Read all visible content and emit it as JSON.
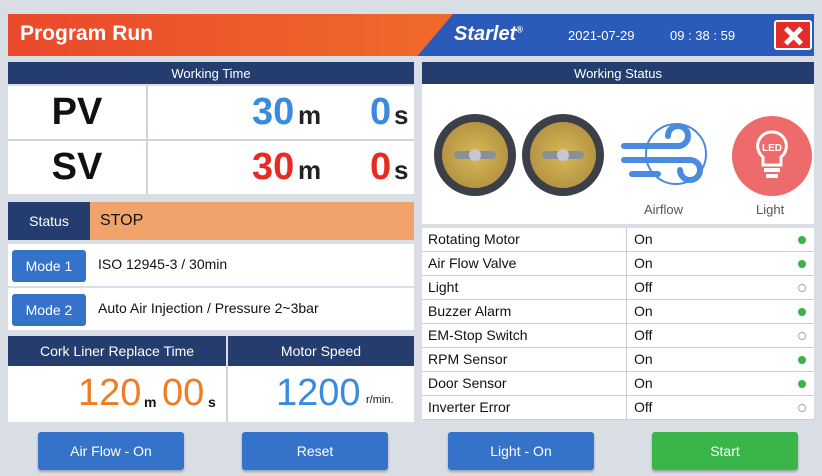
{
  "header": {
    "title": "Program Run",
    "brand": "Starlet",
    "brand_mark": "®",
    "date": "2021-07-29",
    "time": "09 : 38 : 59"
  },
  "working_time": {
    "heading": "Working Time",
    "pv": {
      "label": "PV",
      "min": "30",
      "min_unit": "m",
      "sec": "0",
      "sec_unit": "s"
    },
    "sv": {
      "label": "SV",
      "min": "30",
      "min_unit": "m",
      "sec": "0",
      "sec_unit": "s"
    }
  },
  "status": {
    "label": "Status",
    "value": "STOP"
  },
  "modes": [
    {
      "label": "Mode 1",
      "value": "ISO 12945-3 / 30min"
    },
    {
      "label": "Mode 2",
      "value": "Auto Air Injection / Pressure 2~3bar"
    }
  ],
  "cork": {
    "heading": "Cork Liner Replace Time",
    "min": "120",
    "min_unit": "m",
    "sec": "00",
    "sec_unit": "s"
  },
  "motor": {
    "heading": "Motor Speed",
    "value": "1200",
    "unit": "r/min."
  },
  "working_status": {
    "heading": "Working Status",
    "airflow_caption": "Airflow",
    "light_caption": "Light",
    "light_badge": "LED",
    "rows": [
      {
        "name": "Rotating Motor",
        "value": "On",
        "state": "on"
      },
      {
        "name": "Air Flow Valve",
        "value": "On",
        "state": "on"
      },
      {
        "name": "Light",
        "value": "Off",
        "state": "off"
      },
      {
        "name": "Buzzer Alarm",
        "value": "On",
        "state": "on"
      },
      {
        "name": "EM-Stop Switch",
        "value": "Off",
        "state": "off"
      },
      {
        "name": "RPM Sensor",
        "value": "On",
        "state": "on"
      },
      {
        "name": "Door Sensor",
        "value": "On",
        "state": "on"
      },
      {
        "name": "Inverter Error",
        "value": "Off",
        "state": "off"
      }
    ]
  },
  "buttons": {
    "airflow": "Air Flow - On",
    "reset": "Reset",
    "light": "Light - On",
    "start": "Start"
  },
  "colors": {
    "accent_red": "#e9492c",
    "header_blue": "#2b5bb8",
    "navy": "#243d6e",
    "status_orange": "#f0a36b",
    "on_green": "#3cb34a"
  }
}
